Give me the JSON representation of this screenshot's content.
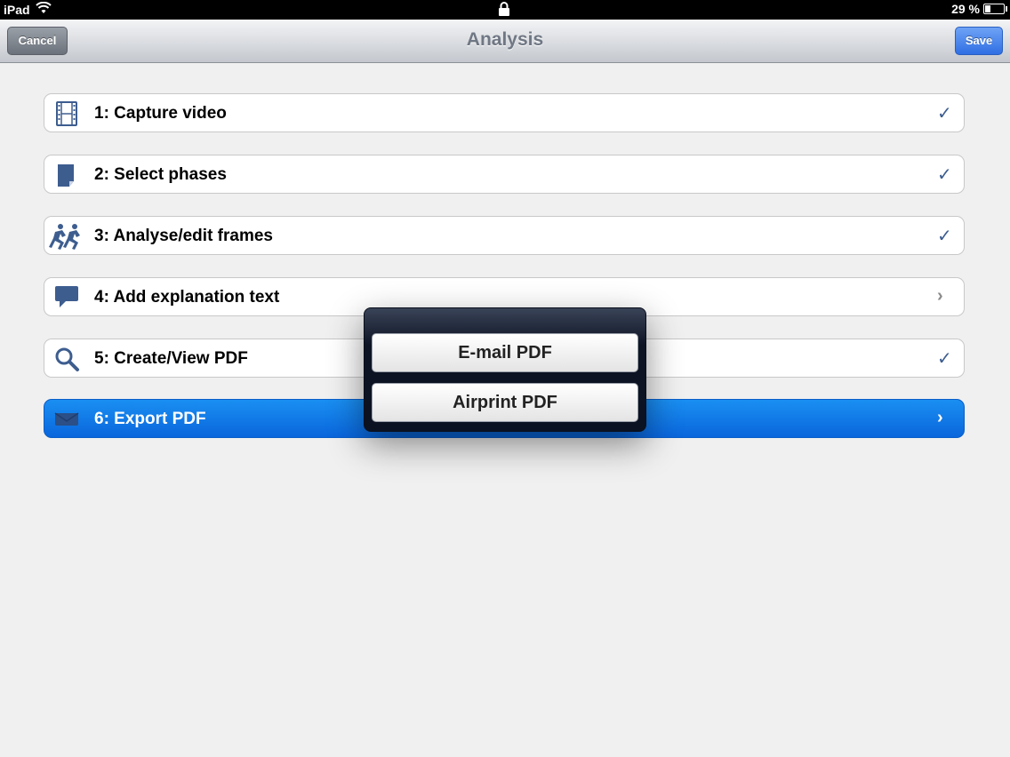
{
  "status_bar": {
    "device": "iPad",
    "battery_percent": "29 %",
    "battery_level": 0.29,
    "icons": [
      "wifi-icon",
      "lock-icon",
      "battery-icon"
    ]
  },
  "navbar": {
    "title": "Analysis",
    "cancel_label": "Cancel",
    "save_label": "Save"
  },
  "steps": [
    {
      "label": "1: Capture video",
      "icon": "film-icon",
      "accessory": "✓",
      "accessory_icon": "checkmark-icon"
    },
    {
      "label": "2: Select phases",
      "icon": "document-icon",
      "accessory": "✓",
      "accessory_icon": "checkmark-icon"
    },
    {
      "label": "3: Analyse/edit frames",
      "icon": "runners-icon",
      "accessory": "✓",
      "accessory_icon": "checkmark-icon"
    },
    {
      "label": "4: Add explanation text",
      "icon": "speech-bubble-icon",
      "accessory": "›",
      "accessory_icon": "chevron-right-icon"
    },
    {
      "label": "5: Create/View PDF",
      "icon": "magnifier-icon",
      "accessory": "✓",
      "accessory_icon": "checkmark-icon"
    },
    {
      "label": "6: Export PDF",
      "icon": "envelope-icon",
      "accessory": "›",
      "accessory_icon": "chevron-right-icon",
      "selected": true
    }
  ],
  "popover": {
    "email_label": "E-mail PDF",
    "airprint_label": "Airprint PDF"
  },
  "colors": {
    "accent_blue": "#0a66dc",
    "icon_blue": "#3d5d8f",
    "background": "#f0f0f0"
  }
}
